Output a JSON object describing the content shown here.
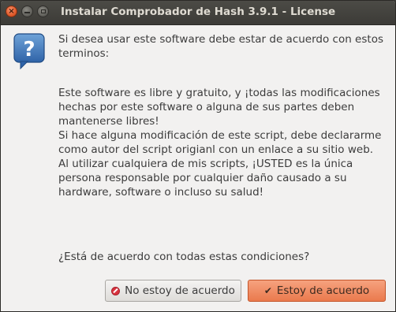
{
  "window": {
    "title": "Instalar Comprobador de Hash 3.9.1 - License",
    "close_glyph": "×"
  },
  "icons": {
    "dialog": "question-icon",
    "no_button": "no-entry-icon",
    "yes_button": "checkmark-icon"
  },
  "message": {
    "intro": "Si desea usar este software debe estar de acuerdo con estos\nterminos:",
    "body": "Este software es libre y gratuito, y ¡todas las modificaciones\nhechas por este software o alguna de sus partes deben\nmantenerse libres!\nSi hace alguna modificación de este script, debe declararme\ncomo autor del script origianl con un enlace a su sitio web.\nAl utilizar cualquiera de mis scripts, ¡USTED es la única\npersona responsable por cualquier daño causado a su\nhardware, software o incluso su salud!",
    "question": "¿Está de acuerdo con todas estas condiciones?"
  },
  "buttons": {
    "no_label": "No estoy de acuerdo",
    "yes_label": "Estoy de acuerdo",
    "yes_glyph": "✔"
  },
  "colors": {
    "accent": "#ea7a4d",
    "titlebar": "#3c3b37",
    "dialog_bg": "#f2f1f0"
  }
}
